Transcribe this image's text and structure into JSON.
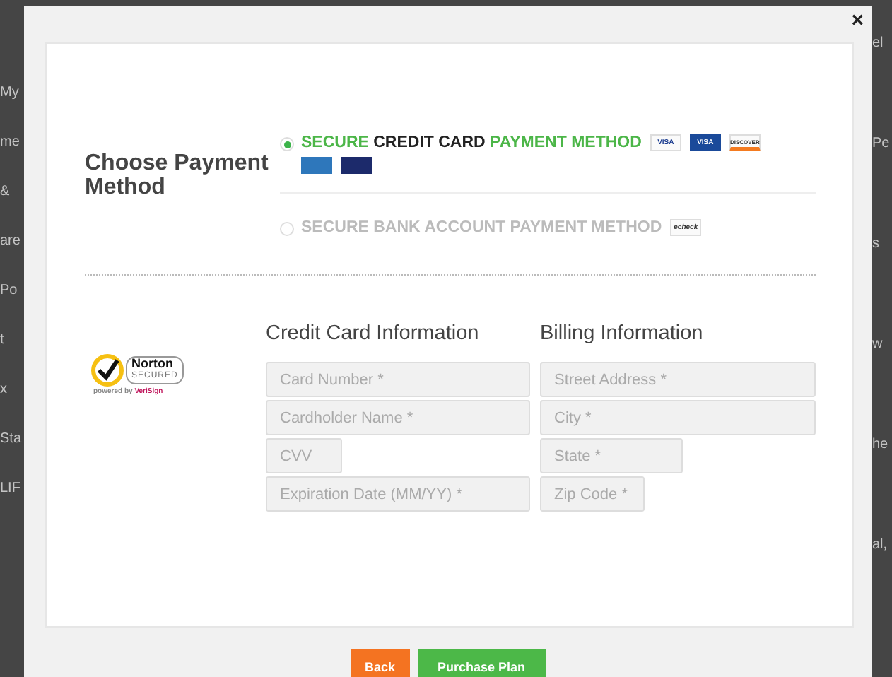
{
  "background": {
    "left_fragments": [
      "My",
      "me",
      "&",
      "are",
      "Po",
      "t",
      "x",
      "Sta",
      "LIF"
    ],
    "right_fragments": [
      "el",
      "Pe",
      "s",
      "w",
      "he",
      "al,"
    ]
  },
  "modal": {
    "close": "×",
    "heading": "Choose Payment Method",
    "payment_methods": [
      {
        "selected": true,
        "label": "SECURE **CREDIT CARD** PAYMENT METHOD",
        "logos": [
          {
            "kind": "visa",
            "text": "VISA"
          },
          {
            "kind": "visa-electron",
            "text": "VISA"
          },
          {
            "kind": "discover",
            "text": "DISCOVER"
          },
          {
            "kind": "amex"
          },
          {
            "kind": "mastercard"
          }
        ]
      },
      {
        "selected": false,
        "label": "SECURE BANK ACCOUNT PAYMENT METHOD",
        "logos": [
          {
            "kind": "echeck",
            "text": "echeck"
          }
        ]
      }
    ],
    "seal": {
      "brand": "Norton",
      "secured": "SECURED",
      "powered_by": "powered by",
      "partner": "VeriSign"
    },
    "sections": [
      {
        "title": "Credit Card Information",
        "fields": [
          {
            "placeholder": "Card Number *"
          },
          {
            "placeholder": "Cardholder Name *"
          },
          {
            "placeholder": "CVV"
          },
          {
            "placeholder": "Expiration Date (MM/YY) *"
          }
        ]
      },
      {
        "title": "Billing Information",
        "fields": [
          {
            "placeholder": "Street Address *"
          },
          {
            "placeholder": "City *"
          },
          {
            "placeholder": "State *"
          },
          {
            "placeholder": "Zip Code *"
          }
        ]
      }
    ],
    "buttons": [
      {
        "label": "Back",
        "kind": "secondary"
      },
      {
        "label": "Purchase Plan",
        "kind": "primary"
      }
    ]
  }
}
